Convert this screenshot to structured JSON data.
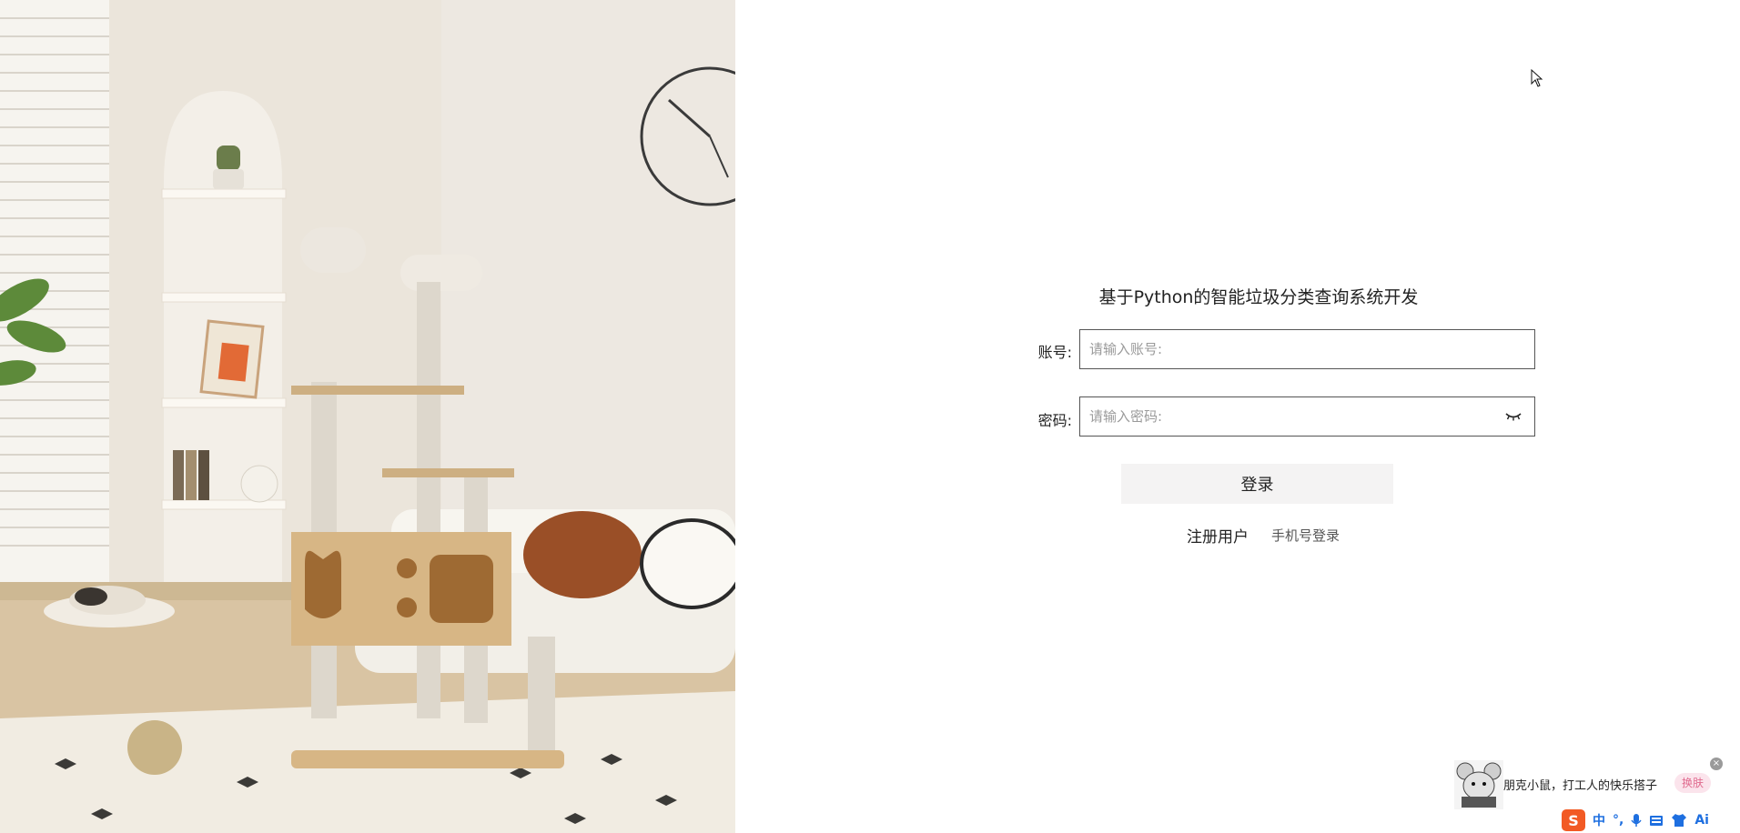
{
  "form": {
    "title": "基于Python的智能垃圾分类查询系统开发",
    "account_label": "账号:",
    "account_placeholder": "请输入账号:",
    "account_value": "",
    "password_label": "密码:",
    "password_placeholder": "请输入密码:",
    "password_value": "",
    "login_button": "登录",
    "register_link": "注册用户",
    "phone_login_link": "手机号登录"
  },
  "ime": {
    "message": "朋克小鼠，打工人的快乐搭子",
    "skin_button": "换肤",
    "close_glyph": "×",
    "toolbar": {
      "logo": "S",
      "mode": "中",
      "punct": "°,",
      "mic_icon": "mic-icon",
      "keyboard_icon": "keyboard-icon",
      "shirt_icon": "shirt-icon",
      "ai": "Ai"
    }
  },
  "icons": {
    "password_toggle": "eye-closed-icon",
    "cursor": "mouse-cursor-icon"
  },
  "colors": {
    "background": "#ffffff",
    "input_border": "#555555",
    "login_button_bg": "#f4f3f3",
    "ime_accent": "#1e6fe0",
    "ime_logo": "#f25a24",
    "skin_button_bg": "#fbe4ec"
  }
}
